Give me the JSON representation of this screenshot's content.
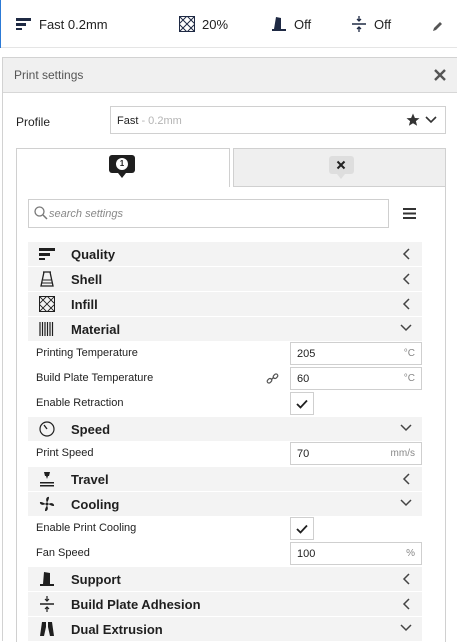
{
  "topbar": {
    "profile": "Fast 0.2mm",
    "infill": "20%",
    "support": "Off",
    "adhesion": "Off"
  },
  "panel": {
    "title": "Print settings",
    "profile_label": "Profile",
    "profile_name": "Fast",
    "profile_sub": " - 0.2mm",
    "tab1_badge": "1",
    "search_placeholder": "search settings"
  },
  "categories": {
    "quality": "Quality",
    "shell": "Shell",
    "infill": "Infill",
    "material": "Material",
    "speed": "Speed",
    "travel": "Travel",
    "cooling": "Cooling",
    "support": "Support",
    "adhesion": "Build Plate Adhesion",
    "dual": "Dual Extrusion"
  },
  "settings": {
    "print_temp": {
      "label": "Printing Temperature",
      "value": "205",
      "unit": "°C"
    },
    "plate_temp": {
      "label": "Build Plate Temperature",
      "value": "60",
      "unit": "°C"
    },
    "retraction": {
      "label": "Enable Retraction",
      "checked": true
    },
    "print_speed": {
      "label": "Print Speed",
      "value": "70",
      "unit": "mm/s"
    },
    "print_cooling": {
      "label": "Enable Print Cooling",
      "checked": true
    },
    "fan_speed": {
      "label": "Fan Speed",
      "value": "100",
      "unit": "%"
    }
  },
  "colors": {
    "accent": "#2c7ad6",
    "category_bg": "#f3f3f3"
  }
}
